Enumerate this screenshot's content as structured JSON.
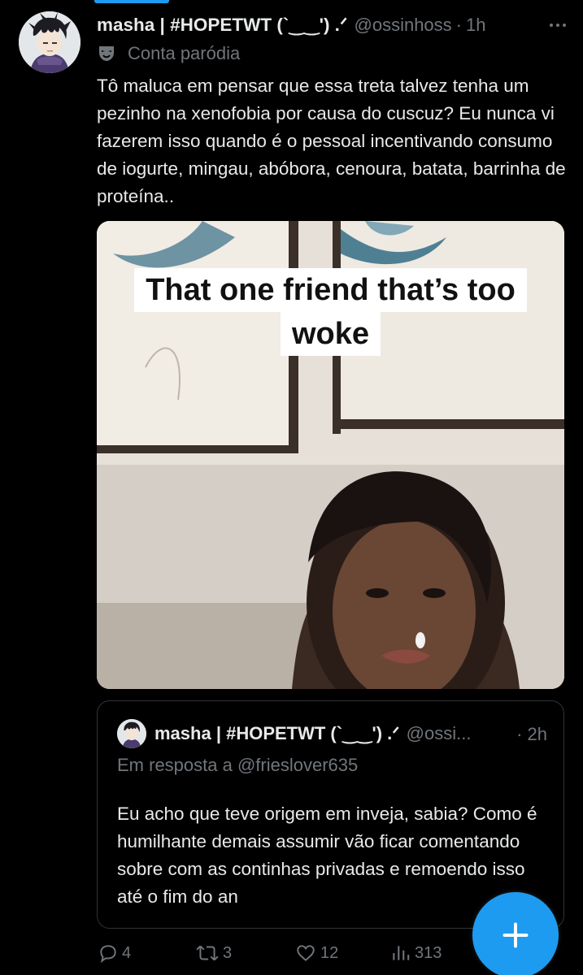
{
  "tweet": {
    "display_name": "masha | #HOPETWT (`‿‿') .ᐟ",
    "handle": "@ossinhoss",
    "separator": "·",
    "time": "1h",
    "parody_label": "Conta paródia",
    "text": "Tô maluca em pensar que essa treta talvez tenha um pezinho na xenofobia por causa do cuscuz? Eu nunca vi fazerem isso quando é o pessoal incentivando consumo de iogurte, mingau, abóbora, cenoura, batata, barrinha de proteína..",
    "media": {
      "caption_line1": "That one friend that’s too",
      "caption_line2": "woke"
    }
  },
  "quote": {
    "display_name": "masha | #HOPETWT (`‿‿') .ᐟ",
    "handle": "@ossi...",
    "separator": "·",
    "time": "2h",
    "reply_to": "Em resposta a @frieslover635",
    "text": "Eu acho que teve origem em inveja, sabia? Como é humilhante demais assumir vão ficar comentando sobre com as continhas privadas e remoendo isso até o fim do an"
  },
  "actions": {
    "replies": "4",
    "retweets": "3",
    "likes": "12",
    "views": "313"
  },
  "icons": {
    "more": "more-horizontal-icon",
    "parody": "theater-mask-icon",
    "reply": "reply-icon",
    "retweet": "retweet-icon",
    "like": "heart-icon",
    "views": "views-chart-icon",
    "compose": "plus-icon"
  },
  "colors": {
    "background": "#000000",
    "text": "#e7e9ea",
    "muted": "#71767b",
    "accent": "#1d9bf0",
    "border": "#2f3336"
  }
}
